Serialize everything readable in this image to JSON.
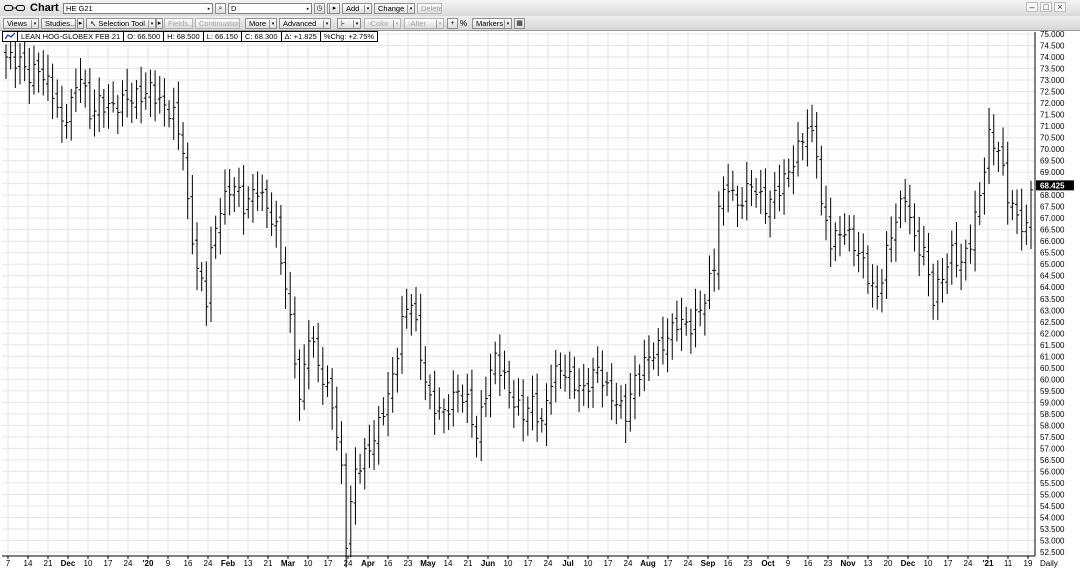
{
  "window": {
    "title": "Chart",
    "symbol": "HE G21",
    "interval": "D"
  },
  "toolbar1": {
    "add_label": "Add",
    "change_label": "Change",
    "delete_label": "Delete"
  },
  "toolbar2": {
    "views_label": "Views",
    "studies_label": "Studies...",
    "selection_tool_label": "Selection Tool",
    "fields_label": "Fields...",
    "continuation_label": "Continuation",
    "more_label": "More",
    "advanced_label": "Advanced",
    "color_label": "Color",
    "alter_label": "Alter",
    "percent_label": "%",
    "markers_label": "Markers"
  },
  "legend": {
    "name": "LEAN HOG-GLOBEX FEB 21",
    "open": "O: 66.500",
    "high": "H: 68.500",
    "low": "L: 66.150",
    "close": "C: 68.300",
    "change": "Δ: +1.825",
    "pct_change": "%Chg: +2.75%"
  },
  "colors": {
    "current_price_bg": "#000000",
    "current_price_text": "#ffffff",
    "bars": "#000000",
    "grid": "#e6e6e6"
  },
  "chart_data": {
    "type": "ohlc",
    "ylim": [
      52.5,
      75.0
    ],
    "y_ticks": [
      "75.000",
      "74.500",
      "74.000",
      "73.500",
      "73.000",
      "72.500",
      "72.000",
      "71.500",
      "71.000",
      "70.500",
      "70.000",
      "69.500",
      "69.000",
      "68.500",
      "68.000",
      "67.500",
      "67.000",
      "66.500",
      "66.000",
      "65.500",
      "65.000",
      "64.500",
      "64.000",
      "63.500",
      "63.000",
      "62.500",
      "62.000",
      "61.500",
      "61.000",
      "60.500",
      "60.000",
      "59.500",
      "59.000",
      "58.500",
      "58.000",
      "57.500",
      "57.000",
      "56.500",
      "56.000",
      "55.500",
      "55.000",
      "54.500",
      "54.000",
      "53.500",
      "53.000",
      "52.500"
    ],
    "current_price": "68.425",
    "x_tick_labels": [
      "7",
      "14",
      "21",
      "Dec",
      "10",
      "17",
      "24",
      "'20",
      "9",
      "16",
      "24",
      "Feb",
      "13",
      "21",
      "Mar",
      "10",
      "17",
      "24",
      "Apr",
      "16",
      "23",
      "May",
      "14",
      "21",
      "Jun",
      "10",
      "17",
      "24",
      "Jul",
      "10",
      "17",
      "24",
      "Aug",
      "17",
      "24",
      "Sep",
      "16",
      "23",
      "Oct",
      "9",
      "16",
      "23",
      "Nov",
      "13",
      "20",
      "Dec",
      "10",
      "17",
      "24",
      "'21",
      "11",
      "19"
    ],
    "x_tick_bold": [
      "Dec",
      "'20",
      "Feb",
      "Mar",
      "Apr",
      "May",
      "Jun",
      "Jul",
      "Aug",
      "Sep",
      "Oct",
      "Nov",
      "Dec",
      "'21"
    ],
    "period_label": "Daily",
    "close_path": [
      {
        "day": 0,
        "close": 74.0
      },
      {
        "day": 3,
        "close": 73.8
      },
      {
        "day": 5,
        "close": 73.2
      },
      {
        "day": 7,
        "close": 73.5
      },
      {
        "day": 10,
        "close": 72.5
      },
      {
        "day": 12,
        "close": 71.0
      },
      {
        "day": 14,
        "close": 72.0
      },
      {
        "day": 16,
        "close": 73.3
      },
      {
        "day": 18,
        "close": 71.5
      },
      {
        "day": 20,
        "close": 72.0
      },
      {
        "day": 23,
        "close": 71.8
      },
      {
        "day": 26,
        "close": 72.2
      },
      {
        "day": 29,
        "close": 72.3
      },
      {
        "day": 31,
        "close": 72.6
      },
      {
        "day": 34,
        "close": 71.8
      },
      {
        "day": 36,
        "close": 71.5
      },
      {
        "day": 38,
        "close": 70.0
      },
      {
        "day": 39,
        "close": 67.5
      },
      {
        "day": 41,
        "close": 64.8
      },
      {
        "day": 43,
        "close": 63.5
      },
      {
        "day": 44,
        "close": 65.5
      },
      {
        "day": 46,
        "close": 67.5
      },
      {
        "day": 49,
        "close": 68.5
      },
      {
        "day": 51,
        "close": 67.5
      },
      {
        "day": 54,
        "close": 68.3
      },
      {
        "day": 57,
        "close": 67.0
      },
      {
        "day": 58,
        "close": 66.5
      },
      {
        "day": 60,
        "close": 64.0
      },
      {
        "day": 62,
        "close": 61.0
      },
      {
        "day": 63,
        "close": 59.0
      },
      {
        "day": 65,
        "close": 62.0
      },
      {
        "day": 68,
        "close": 60.0
      },
      {
        "day": 70,
        "close": 59.0
      },
      {
        "day": 72,
        "close": 56.0
      },
      {
        "day": 73,
        "close": 53.0
      },
      {
        "day": 75,
        "close": 56.0
      },
      {
        "day": 78,
        "close": 57.0
      },
      {
        "day": 80,
        "close": 58.0
      },
      {
        "day": 83,
        "close": 60.0
      },
      {
        "day": 85,
        "close": 62.5
      },
      {
        "day": 87,
        "close": 63.5
      },
      {
        "day": 89,
        "close": 61.0
      },
      {
        "day": 91,
        "close": 59.0
      },
      {
        "day": 94,
        "close": 58.5
      },
      {
        "day": 97,
        "close": 59.5
      },
      {
        "day": 99,
        "close": 59.0
      },
      {
        "day": 101,
        "close": 57.5
      },
      {
        "day": 103,
        "close": 59.5
      },
      {
        "day": 105,
        "close": 61.0
      },
      {
        "day": 107,
        "close": 60.0
      },
      {
        "day": 109,
        "close": 59.0
      },
      {
        "day": 111,
        "close": 58.5
      },
      {
        "day": 113,
        "close": 59.0
      },
      {
        "day": 115,
        "close": 58.0
      },
      {
        "day": 117,
        "close": 60.0
      },
      {
        "day": 119,
        "close": 60.5
      },
      {
        "day": 121,
        "close": 60.0
      },
      {
        "day": 124,
        "close": 59.5
      },
      {
        "day": 127,
        "close": 60.5
      },
      {
        "day": 129,
        "close": 59.5
      },
      {
        "day": 131,
        "close": 59.0
      },
      {
        "day": 133,
        "close": 58.5
      },
      {
        "day": 135,
        "close": 60.0
      },
      {
        "day": 138,
        "close": 61.0
      },
      {
        "day": 141,
        "close": 61.5
      },
      {
        "day": 144,
        "close": 62.5
      },
      {
        "day": 147,
        "close": 62.3
      },
      {
        "day": 150,
        "close": 63.5
      },
      {
        "day": 152,
        "close": 65.0
      },
      {
        "day": 153,
        "close": 67.5
      },
      {
        "day": 155,
        "close": 68.5
      },
      {
        "day": 157,
        "close": 67.5
      },
      {
        "day": 160,
        "close": 68.5
      },
      {
        "day": 163,
        "close": 67.5
      },
      {
        "day": 165,
        "close": 68.0
      },
      {
        "day": 168,
        "close": 69.0
      },
      {
        "day": 170,
        "close": 70.0
      },
      {
        "day": 172,
        "close": 71.0
      },
      {
        "day": 174,
        "close": 70.0
      },
      {
        "day": 175,
        "close": 67.5
      },
      {
        "day": 177,
        "close": 66.0
      },
      {
        "day": 180,
        "close": 66.5
      },
      {
        "day": 183,
        "close": 65.5
      },
      {
        "day": 185,
        "close": 64.5
      },
      {
        "day": 187,
        "close": 63.5
      },
      {
        "day": 189,
        "close": 65.5
      },
      {
        "day": 191,
        "close": 67.0
      },
      {
        "day": 193,
        "close": 68.0
      },
      {
        "day": 195,
        "close": 66.0
      },
      {
        "day": 197,
        "close": 65.5
      },
      {
        "day": 199,
        "close": 63.5
      },
      {
        "day": 201,
        "close": 64.5
      },
      {
        "day": 203,
        "close": 65.5
      },
      {
        "day": 205,
        "close": 65.0
      },
      {
        "day": 207,
        "close": 66.0
      },
      {
        "day": 209,
        "close": 68.0
      },
      {
        "day": 211,
        "close": 70.5
      },
      {
        "day": 213,
        "close": 70.0
      },
      {
        "day": 215,
        "close": 68.0
      },
      {
        "day": 217,
        "close": 67.0
      },
      {
        "day": 219,
        "close": 66.5
      },
      {
        "day": 220,
        "close": 68.3
      }
    ]
  }
}
